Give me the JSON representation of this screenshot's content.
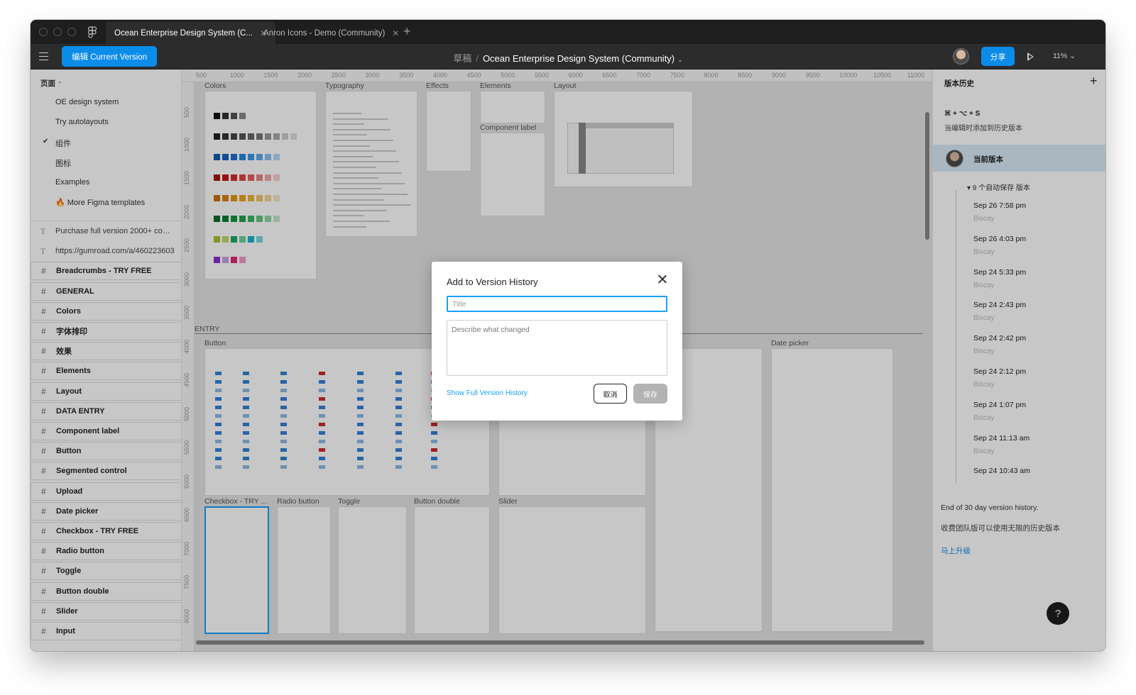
{
  "tabs": [
    {
      "label": "Ocean Enterprise Design System (C..."
    },
    {
      "label": "Anron Icons - Demo (Community)"
    }
  ],
  "toolbar": {
    "edit_label": "编辑 Current Version",
    "breadcrumb_draft": "草稿",
    "breadcrumb_file": "Ocean Enterprise Design System (Community)",
    "share_label": "分享",
    "zoom": "11%"
  },
  "pages": {
    "header": "页面",
    "items": [
      {
        "label": "OE design system"
      },
      {
        "label": "Try autolayouts"
      },
      {
        "label": "组件"
      },
      {
        "label": "图标"
      },
      {
        "label": "Examples"
      },
      {
        "label": "🔥 More Figma templates"
      }
    ]
  },
  "layers": [
    {
      "label": "Purchase full version 2000+ comp...",
      "type": "text"
    },
    {
      "label": "https://gumroad.com/a/460223603",
      "type": "text"
    },
    {
      "label": "Breadcrumbs - TRY FREE",
      "type": "frame"
    },
    {
      "label": "GENERAL",
      "type": "frame"
    },
    {
      "label": "Colors",
      "type": "frame"
    },
    {
      "label": "字体排印",
      "type": "frame"
    },
    {
      "label": "效果",
      "type": "frame"
    },
    {
      "label": "Elements",
      "type": "frame"
    },
    {
      "label": "Layout",
      "type": "frame"
    },
    {
      "label": "DATA ENTRY",
      "type": "frame"
    },
    {
      "label": "Component label",
      "type": "frame"
    },
    {
      "label": "Button",
      "type": "frame"
    },
    {
      "label": "Segmented control",
      "type": "frame"
    },
    {
      "label": "Upload",
      "type": "frame"
    },
    {
      "label": "Date picker",
      "type": "frame"
    },
    {
      "label": "Checkbox - TRY FREE",
      "type": "frame"
    },
    {
      "label": "Radio button",
      "type": "frame"
    },
    {
      "label": "Toggle",
      "type": "frame"
    },
    {
      "label": "Button double",
      "type": "frame"
    },
    {
      "label": "Slider",
      "type": "frame"
    },
    {
      "label": "Input",
      "type": "frame"
    }
  ],
  "canvas": {
    "ruler_top": [
      "500",
      "1000",
      "1500",
      "2000",
      "2500",
      "3000",
      "3500",
      "4000",
      "4500",
      "5000",
      "5500",
      "6000",
      "6500",
      "7000",
      "7500",
      "8000",
      "8500",
      "9000",
      "9500",
      "10000",
      "10500",
      "11000"
    ],
    "ruler_left": [
      "500",
      "1000",
      "1500",
      "2000",
      "2500",
      "3000",
      "3500",
      "4000",
      "4500",
      "5000",
      "5500",
      "6000",
      "6500",
      "7000",
      "7500",
      "8000"
    ],
    "frame_labels": {
      "colors": "Colors",
      "typography": "Typography",
      "effects": "Effects",
      "elements": "Elements",
      "layout": "Layout",
      "component_label": "Component label",
      "entry": "ENTRY",
      "button": "Button",
      "date_picker": "Date picker",
      "checkbox": "Checkbox - TRY ...",
      "radio": "Radio button",
      "toggle": "Toggle",
      "button_double": "Button double",
      "slider": "Slider"
    }
  },
  "version_panel": {
    "title": "版本历史",
    "shortcut": "⌘ + ⌥ + S",
    "hint": "当编辑时添加到历史版本",
    "current": "当前版本",
    "autosave": "▾ 9 个自动保存 版本",
    "versions": [
      {
        "time": "Sep 26 7:58 pm",
        "author": "Biscay"
      },
      {
        "time": "Sep 26 4:03 pm",
        "author": "Biscay"
      },
      {
        "time": "Sep 24 5:33 pm",
        "author": "Biscay"
      },
      {
        "time": "Sep 24 2:43 pm",
        "author": "Biscay"
      },
      {
        "time": "Sep 24 2:42 pm",
        "author": "Biscay"
      },
      {
        "time": "Sep 24 2:12 pm",
        "author": "Biscay"
      },
      {
        "time": "Sep 24 1:07 pm",
        "author": "Biscay"
      },
      {
        "time": "Sep 24 11:13 am",
        "author": "Biscay"
      },
      {
        "time": "Sep 24 10:43 am",
        "author": ""
      }
    ],
    "end_note": "End of 30 day version history.",
    "paid_note": "收费团队版可以使用无限的历史版本",
    "upgrade": "马上升级",
    "help": "?"
  },
  "modal": {
    "title": "Add to Version History",
    "title_placeholder": "Title",
    "title_value": "",
    "desc_placeholder": "Describe what changed",
    "desc_value": "",
    "show_history": "Show Full Version History",
    "cancel": "取消",
    "save": "保存"
  },
  "colors": {
    "accent": "#0c8ce9",
    "focus": "#18a0fb",
    "dark_chrome": "#2c2c2c",
    "selected_row": "#daebf7"
  }
}
